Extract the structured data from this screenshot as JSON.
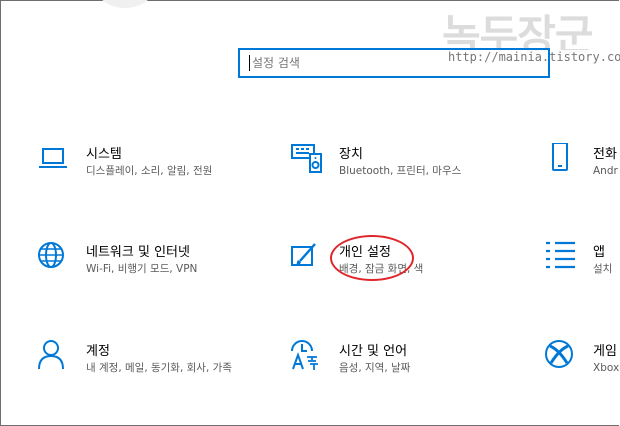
{
  "watermark": {
    "title": "녹두장군",
    "url": "http://mainia.tistory.com"
  },
  "search": {
    "placeholder": "설정 검색"
  },
  "tiles": [
    {
      "title": "시스템",
      "desc": "디스플레이, 소리, 알림, 전원",
      "icon": "laptop-icon"
    },
    {
      "title": "장치",
      "desc": "Bluetooth, 프린터, 마우스",
      "icon": "keyboard-speaker-icon"
    },
    {
      "title": "전화",
      "desc": "Andr",
      "icon": "phone-icon"
    },
    {
      "title": "네트워크 및 인터넷",
      "desc": "Wi-Fi, 비행기 모드, VPN",
      "icon": "globe-icon"
    },
    {
      "title": "개인 설정",
      "desc": "배경, 잠금 화면, 색",
      "icon": "paint-brush-icon"
    },
    {
      "title": "앱",
      "desc": "설치",
      "icon": "apps-list-icon"
    },
    {
      "title": "계정",
      "desc": "내 계정, 메일, 동기화, 회사, 가족",
      "icon": "person-icon"
    },
    {
      "title": "시간 및 언어",
      "desc": "음성, 지역, 날짜",
      "icon": "time-language-icon"
    },
    {
      "title": "게임",
      "desc": "Xbox",
      "icon": "xbox-icon"
    }
  ],
  "colors": {
    "accent": "#0078d7",
    "highlight": "#e0262a"
  }
}
